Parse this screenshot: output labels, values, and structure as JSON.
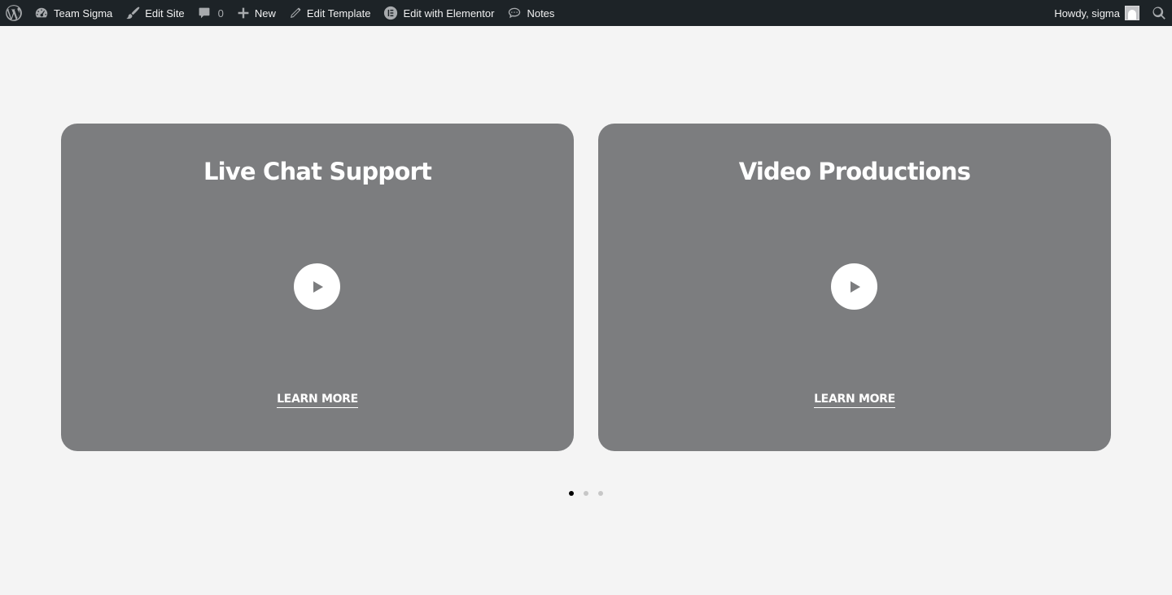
{
  "adminbar": {
    "site_name": "Team Sigma",
    "edit_site": "Edit Site",
    "comments_count": "0",
    "new_label": "New",
    "edit_template": "Edit Template",
    "edit_elementor": "Edit with Elementor",
    "notes": "Notes",
    "howdy": "Howdy, sigma",
    "icons": [
      "wordpress-icon",
      "dashboard-icon",
      "brush-icon",
      "comment-icon",
      "plus-icon",
      "pencil-icon",
      "elementor-icon",
      "notes-icon",
      "search-icon"
    ]
  },
  "cards": [
    {
      "title": "Live Chat Support",
      "link_label": "LEARN MORE"
    },
    {
      "title": "Video Productions",
      "link_label": "LEARN MORE"
    }
  ],
  "carousel": {
    "pages": 3,
    "active_page": 1
  },
  "colors": {
    "adminbar_bg": "#1d2327",
    "card_bg": "#7c7d7f",
    "page_bg": "#f4f4f4",
    "dot_active": "#000000",
    "dot_inactive": "#c7c7c7"
  }
}
